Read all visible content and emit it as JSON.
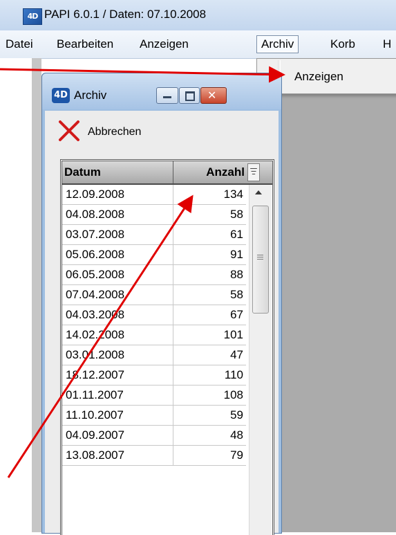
{
  "app": {
    "title": "PAPI 6.0.1 / Daten: 07.10.2008",
    "icon": "4D-app-icon"
  },
  "menubar": {
    "items": [
      "Datei",
      "Bearbeiten",
      "Anzeigen",
      "Archiv",
      "Korb",
      "H"
    ],
    "active": "Archiv"
  },
  "dropdown": {
    "items": [
      "Anzeigen"
    ]
  },
  "archiv_window": {
    "title": "Archiv",
    "toolbar": {
      "cancel_label": "Abbrechen",
      "cancel_icon": "red-x-icon"
    },
    "table": {
      "columns": [
        "Datum",
        "Anzahl"
      ],
      "rows": [
        {
          "datum": "12.09.2008",
          "anzahl": "134"
        },
        {
          "datum": "04.08.2008",
          "anzahl": "58"
        },
        {
          "datum": "03.07.2008",
          "anzahl": "61"
        },
        {
          "datum": "05.06.2008",
          "anzahl": "91"
        },
        {
          "datum": "06.05.2008",
          "anzahl": "88"
        },
        {
          "datum": "07.04.2008",
          "anzahl": "58"
        },
        {
          "datum": "04.03.2008",
          "anzahl": "67"
        },
        {
          "datum": "14.02.2008",
          "anzahl": "101"
        },
        {
          "datum": "03.01.2008",
          "anzahl": "47"
        },
        {
          "datum": "18.12.2007",
          "anzahl": "110"
        },
        {
          "datum": "01.11.2007",
          "anzahl": "108"
        },
        {
          "datum": "11.10.2007",
          "anzahl": "59"
        },
        {
          "datum": "04.09.2007",
          "anzahl": "48"
        },
        {
          "datum": "13.08.2007",
          "anzahl": "79"
        }
      ]
    }
  },
  "colors": {
    "annotation_arrow": "#e00000",
    "desktop": "#ababab",
    "window_frame": "#9fbfe2"
  }
}
